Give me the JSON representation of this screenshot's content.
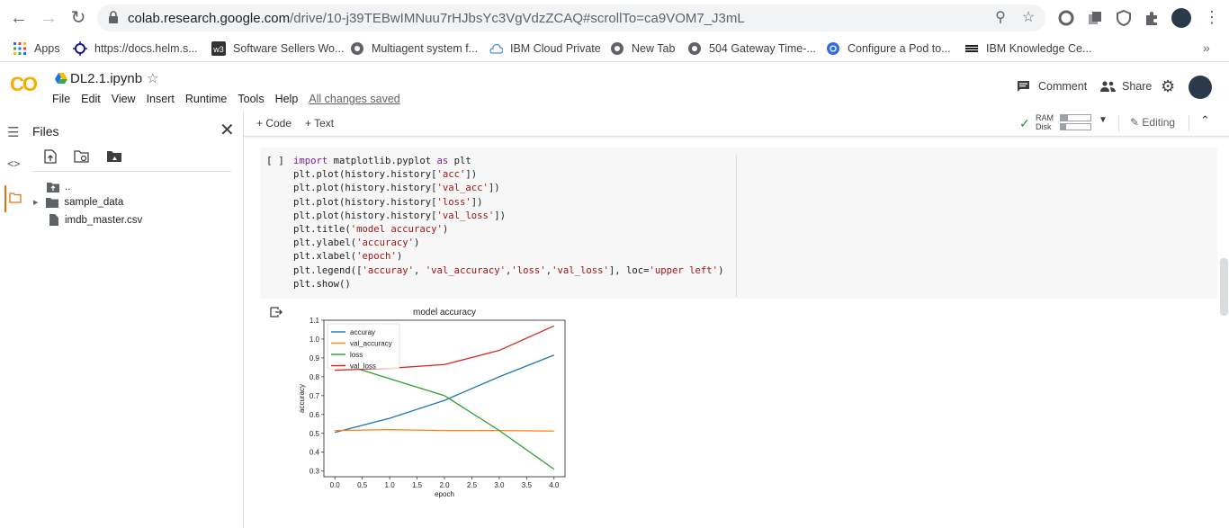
{
  "browser": {
    "url_host": "colab.research.google.com",
    "url_path": "/drive/10-j39TEBwIMNuu7rHJbsYc3VgVdzZCAQ#scrollTo=ca9VOM7_J3mL"
  },
  "bookmarks": [
    {
      "label": "Apps",
      "icon": "apps-grid-icon"
    },
    {
      "label": "https://docs.helm.s...",
      "icon": "helm-icon"
    },
    {
      "label": "Software Sellers Wo...",
      "icon": "w3-icon"
    },
    {
      "label": "Multiagent system f...",
      "icon": "globe-icon"
    },
    {
      "label": "IBM Cloud Private",
      "icon": "cloud-icon"
    },
    {
      "label": "New Tab",
      "icon": "globe-icon"
    },
    {
      "label": "504 Gateway Time-...",
      "icon": "globe-icon"
    },
    {
      "label": "Configure a Pod to...",
      "icon": "kubernetes-icon"
    },
    {
      "label": "IBM Knowledge Ce...",
      "icon": "ibm-icon"
    }
  ],
  "colab": {
    "logo": "CO",
    "notebook_name": "DL2.1.ipynb",
    "menu": [
      "File",
      "Edit",
      "View",
      "Insert",
      "Runtime",
      "Tools",
      "Help"
    ],
    "save_status": "All changes saved",
    "comment": "Comment",
    "share": "Share",
    "toolbar": {
      "add_code": "+ Code",
      "add_text": "+ Text",
      "ram": "RAM",
      "disk": "Disk",
      "editing": "Editing"
    }
  },
  "sidebar": {
    "title": "Files",
    "tree": [
      {
        "label": "..",
        "icon": "folder-up-icon"
      },
      {
        "label": "sample_data",
        "icon": "folder-icon"
      },
      {
        "label": "imdb_master.csv",
        "icon": "file-icon"
      }
    ]
  },
  "cell": {
    "run_indicator": "[ ]",
    "code_lines": [
      "import matplotlib.pyplot as plt",
      "plt.plot(history.history['acc'])",
      "plt.plot(history.history['val_acc'])",
      "plt.plot(history.history['loss'])",
      "plt.plot(history.history['val_loss'])",
      "plt.title('model accuracy')",
      "plt.ylabel('accuracy')",
      "plt.xlabel('epoch')",
      "plt.legend(['accuray', 'val_accuracy','loss','val_loss'], loc='upper left')",
      "plt.show()"
    ]
  },
  "chart_data": {
    "type": "line",
    "title": "model accuracy",
    "xlabel": "epoch",
    "ylabel": "accuracy",
    "x": [
      0,
      1,
      2,
      3,
      4
    ],
    "xlim": [
      -0.2,
      4.2
    ],
    "ylim": [
      0.27,
      1.1
    ],
    "xticks": [
      "0.0",
      "0.5",
      "1.0",
      "1.5",
      "2.0",
      "2.5",
      "3.0",
      "3.5",
      "4.0"
    ],
    "yticks": [
      "0.3",
      "0.4",
      "0.5",
      "0.6",
      "0.7",
      "0.8",
      "0.9",
      "1.0",
      "1.1"
    ],
    "legend_position": "upper left",
    "series": [
      {
        "name": "accuray",
        "color": "#1f77b4",
        "values": [
          0.505,
          0.58,
          0.675,
          0.8,
          0.915
        ]
      },
      {
        "name": "val_accuracy",
        "color": "#ff7f0e",
        "values": [
          0.515,
          0.52,
          0.515,
          0.515,
          0.512
        ]
      },
      {
        "name": "loss",
        "color": "#2ca02c",
        "values": [
          0.88,
          0.79,
          0.7,
          0.515,
          0.31
        ]
      },
      {
        "name": "val_loss",
        "color": "#d62728",
        "values": [
          0.835,
          0.845,
          0.865,
          0.94,
          1.07
        ]
      }
    ]
  }
}
